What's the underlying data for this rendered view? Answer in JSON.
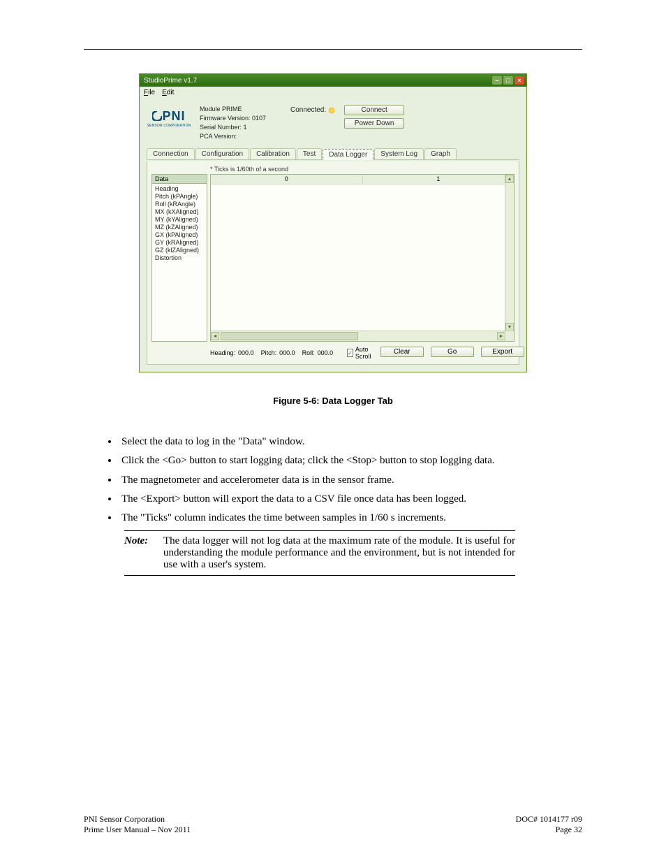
{
  "app": {
    "title": "StudioPrime v1.7",
    "menu": {
      "file": "File",
      "edit": "Edit"
    },
    "win": {
      "min": "–",
      "max": "□",
      "close": "×"
    },
    "logo": {
      "text": "PNI",
      "subtitle": "SENSOR CORPORATION"
    },
    "info": {
      "module": "Module PRIME",
      "firmware": "Firmware Version: 0107",
      "serial": "Serial Number: 1",
      "pca": "PCA Version:"
    },
    "conn": {
      "label": "Connected:",
      "connect_btn": "Connect",
      "powerdown_btn": "Power Down"
    },
    "tabs": [
      "Connection",
      "Configuration",
      "Calibration",
      "Test",
      "Data Logger",
      "System Log",
      "Graph"
    ],
    "selected_tab": "Data Logger",
    "ticks_note": "* Ticks is 1/60th of a second",
    "data_header": "Data",
    "data_items": [
      "Heading",
      "Pitch (kPAngle)",
      "Roll (kRAngle)",
      "MX (kXAligned)",
      "MY (kYAligned)",
      "MZ (kZAligned)",
      "GX (kPAligned)",
      "GY (kRAligned)",
      "GZ (klZAligned)",
      "Distortion"
    ],
    "grid_cols": [
      "0",
      "1"
    ],
    "footer": {
      "heading_label": "Heading:",
      "heading_val": "000.0",
      "pitch_label": "Pitch:",
      "pitch_val": "000.0",
      "roll_label": "Roll:",
      "roll_val": "000.0",
      "autoscroll": "Auto Scroll",
      "clear": "Clear",
      "go": "Go",
      "export": "Export"
    }
  },
  "figure_caption": "Figure 5-6:  Data Logger Tab",
  "bullets": [
    "Select the data to log in the \"Data\" window.",
    "Click the <Go> button to start logging data; click the <Stop> button to stop logging data.",
    "The magnetometer and accelerometer data is in the sensor frame.",
    "The <Export> button will export the data to a CSV file once data has been logged.",
    "The \"Ticks\" column indicates the time between samples in 1/60 s increments."
  ],
  "note_label": "Note:",
  "note_body": "The data logger will not log data at the maximum rate of the module.  It is useful for understanding the module performance and the environment, but is not intended for use with a user's system.",
  "footer_left": "PNI Sensor Corporation",
  "footer_right": "DOC# 1014177 r09",
  "footer_mid_left": "Prime User Manual – Nov 2011",
  "footer_mid_right": "Page 32"
}
